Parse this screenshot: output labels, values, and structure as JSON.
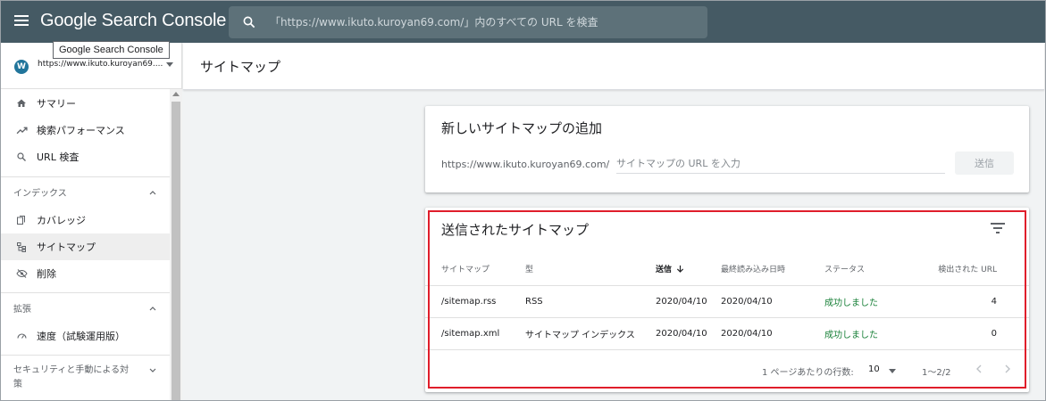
{
  "topbar": {
    "app_title": "Google Search Console",
    "search_placeholder": "「https://www.ikuto.kuroyan69.com/」内のすべての URL を検査",
    "bg_color": "#455a64"
  },
  "tooltip": {
    "text": "Google Search Console"
  },
  "property": {
    "icon": "wordpress-icon",
    "url": "https://www.ikuto.kuroyan69...."
  },
  "sidebar": {
    "items_top": [
      {
        "label": "サマリー",
        "icon": "home-icon"
      },
      {
        "label": "検索パフォーマンス",
        "icon": "trending-up-icon"
      },
      {
        "label": "URL 検査",
        "icon": "search-icon"
      }
    ],
    "section_index": {
      "label": "インデックス"
    },
    "items_index": [
      {
        "label": "カバレッジ",
        "icon": "copy-icon"
      },
      {
        "label": "サイトマップ",
        "icon": "sitemap-icon",
        "active": true
      },
      {
        "label": "削除",
        "icon": "visibility-off-icon"
      }
    ],
    "section_enhance": {
      "label": "拡張"
    },
    "items_enhance": [
      {
        "label": "速度（試験運用版）",
        "icon": "speed-icon"
      }
    ],
    "section_security": {
      "label": "セキュリティと手動による対策"
    }
  },
  "page": {
    "title": "サイトマップ"
  },
  "add_card": {
    "title": "新しいサイトマップの追加",
    "url_prefix": "https://www.ikuto.kuroyan69.com/",
    "input_placeholder": "サイトマップの URL を入力",
    "submit_label": "送信"
  },
  "submitted_card": {
    "title": "送信されたサイトマップ",
    "columns": [
      "サイトマップ",
      "型",
      "送信",
      "最終読み込み日時",
      "ステータス",
      "検出された URL"
    ],
    "rows": [
      {
        "sitemap": "/sitemap.rss",
        "type": "RSS",
        "submitted": "2020/04/10",
        "last_read": "2020/04/10",
        "status": "成功しました",
        "urls": "4"
      },
      {
        "sitemap": "/sitemap.xml",
        "type": "サイトマップ インデックス",
        "submitted": "2020/04/10",
        "last_read": "2020/04/10",
        "status": "成功しました",
        "urls": "0"
      }
    ],
    "pagination": {
      "rows_per_page_label": "1 ページあたりの行数:",
      "rows_per_page_value": "10",
      "range": "1～2/2"
    },
    "status_color": "#188038",
    "highlight_color": "#e01e2b"
  }
}
